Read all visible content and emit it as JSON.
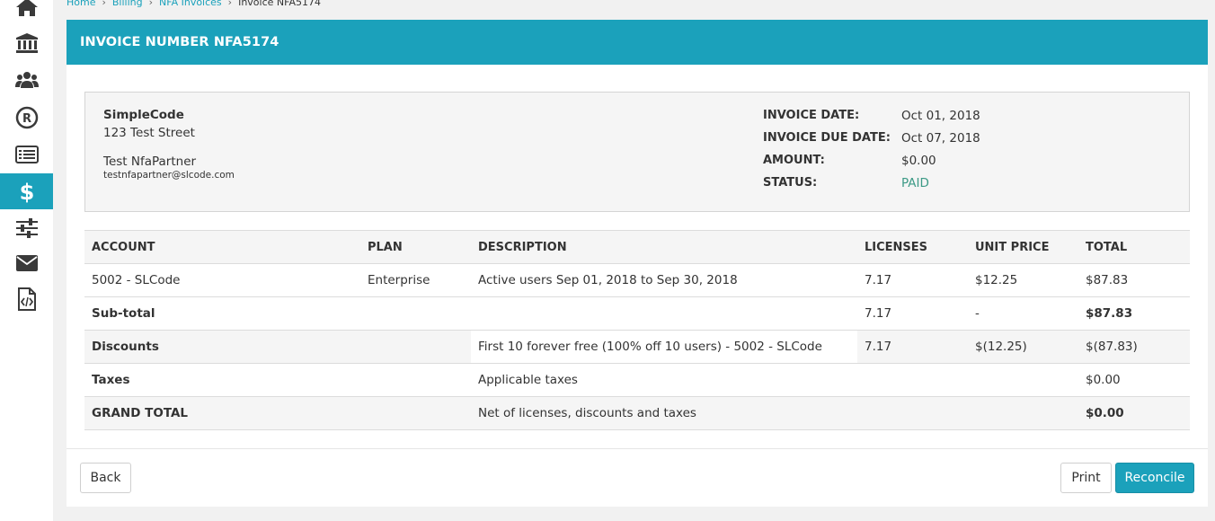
{
  "sidebar": {
    "items": [
      {
        "icon": "home-icon"
      },
      {
        "icon": "bank-icon"
      },
      {
        "icon": "users-icon"
      },
      {
        "icon": "registered-icon"
      },
      {
        "icon": "list-icon"
      },
      {
        "icon": "dollar-icon",
        "active": true
      },
      {
        "icon": "sliders-icon"
      },
      {
        "icon": "envelope-icon"
      },
      {
        "icon": "code-file-icon"
      }
    ],
    "accent": "#1ba1bb"
  },
  "breadcrumb": {
    "items": [
      "Home",
      "Billing",
      "NFA Invoices",
      "Invoice NFA5174"
    ],
    "separator": "›"
  },
  "panel": {
    "title": "INVOICE NUMBER NFA5174",
    "header_color": "#1ba1bb"
  },
  "bill_to": {
    "company": "SimpleCode",
    "street": "123 Test Street",
    "contact_name": "Test NfaPartner",
    "contact_email": "testnfapartner@slcode.com"
  },
  "invoice_meta": {
    "date_label": "INVOICE DATE:",
    "date_value": "Oct 01, 2018",
    "due_label": "INVOICE DUE DATE:",
    "due_value": "Oct 07, 2018",
    "amount_label": "AMOUNT:",
    "amount_value": "$0.00",
    "status_label": "STATUS:",
    "status_value": "PAID",
    "status_color": "#3c9a86"
  },
  "table": {
    "headers": [
      "ACCOUNT",
      "PLAN",
      "DESCRIPTION",
      "LICENSES",
      "UNIT PRICE",
      "TOTAL"
    ],
    "rows": [
      [
        "5002 - SLCode",
        "Enterprise",
        "Active users Sep 01, 2018 to Sep 30, 2018",
        "7.17",
        "$12.25",
        "$87.83"
      ],
      [
        "Sub-total",
        "",
        "",
        "7.17",
        "-",
        "$87.83"
      ],
      [
        "Discounts",
        "",
        "First 10 forever free (100% off 10 users) - 5002 - SLCode",
        "7.17",
        "$(12.25)",
        "$(87.83)"
      ],
      [
        "Taxes",
        "",
        "Applicable taxes",
        "",
        "",
        "$0.00"
      ],
      [
        "GRAND TOTAL",
        "",
        "Net of licenses, discounts and taxes",
        "",
        "",
        "$0.00"
      ]
    ]
  },
  "buttons": {
    "back": "Back",
    "print": "Print",
    "reconcile": "Reconcile"
  }
}
